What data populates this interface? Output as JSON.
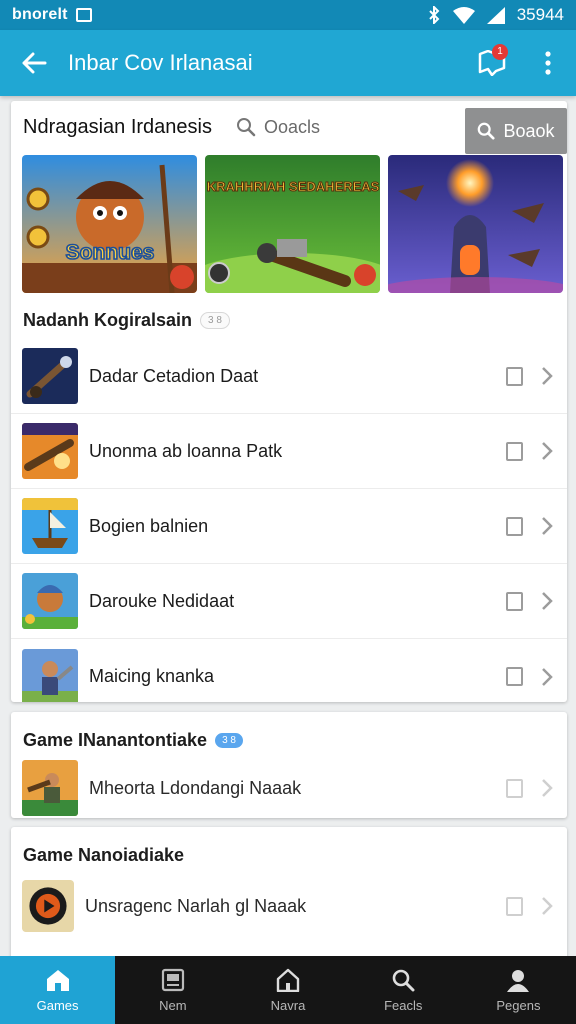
{
  "status_bar": {
    "carrier": "bnorelt",
    "time": "35944"
  },
  "app_bar": {
    "title": "Inbar Cov Irlanasai",
    "notification_count": "1"
  },
  "featured": {
    "title": "Ndragasian Irdanesis",
    "search_placeholder": "Ooacls",
    "search_button": "Boaok",
    "banners": [
      {
        "name": "Sonnues",
        "text": "Sonnues",
        "theme": "pirate"
      },
      {
        "name": "Sedahereas",
        "text": "KRAHHRIAH SEDAHEREAS",
        "theme": "jungle-cannon"
      },
      {
        "name": "Tower",
        "text": "",
        "theme": "night-tower"
      }
    ]
  },
  "section1": {
    "title": "Nadanh Kogiralsain",
    "badge": "3 8",
    "items": [
      {
        "label": "Dadar Cetadion Daat",
        "thumb": "cannon"
      },
      {
        "label": "Unonma ab loanna Patk",
        "thumb": "sunset"
      },
      {
        "label": "Bogien balnien",
        "thumb": "ship"
      },
      {
        "label": "Darouke Nedidaat",
        "thumb": "hero"
      },
      {
        "label": "Maicing knanka",
        "thumb": "warrior"
      }
    ]
  },
  "section2": {
    "title": "Game INanantontiake",
    "badge": "3 8",
    "items": [
      {
        "label": "Mheorta Ldondangi Naaak",
        "thumb": "soldier"
      }
    ]
  },
  "section3": {
    "title": "Game Nanoiadiake",
    "items": [
      {
        "label": "Unsragenc Narlah gl Naaak",
        "thumb": "play"
      }
    ]
  },
  "bottom_nav": [
    {
      "label": "Games",
      "icon": "home-icon",
      "active": true
    },
    {
      "label": "Nem",
      "icon": "inbox-icon",
      "active": false
    },
    {
      "label": "Navra",
      "icon": "house-icon",
      "active": false
    },
    {
      "label": "Feacls",
      "icon": "search-icon",
      "active": false
    },
    {
      "label": "Pegens",
      "icon": "person-icon",
      "active": false
    }
  ],
  "colors": {
    "status_bar": "#1289b6",
    "app_bar": "#20a7d3",
    "nav_active": "#1fa3d4",
    "nav_background": "#151515"
  }
}
